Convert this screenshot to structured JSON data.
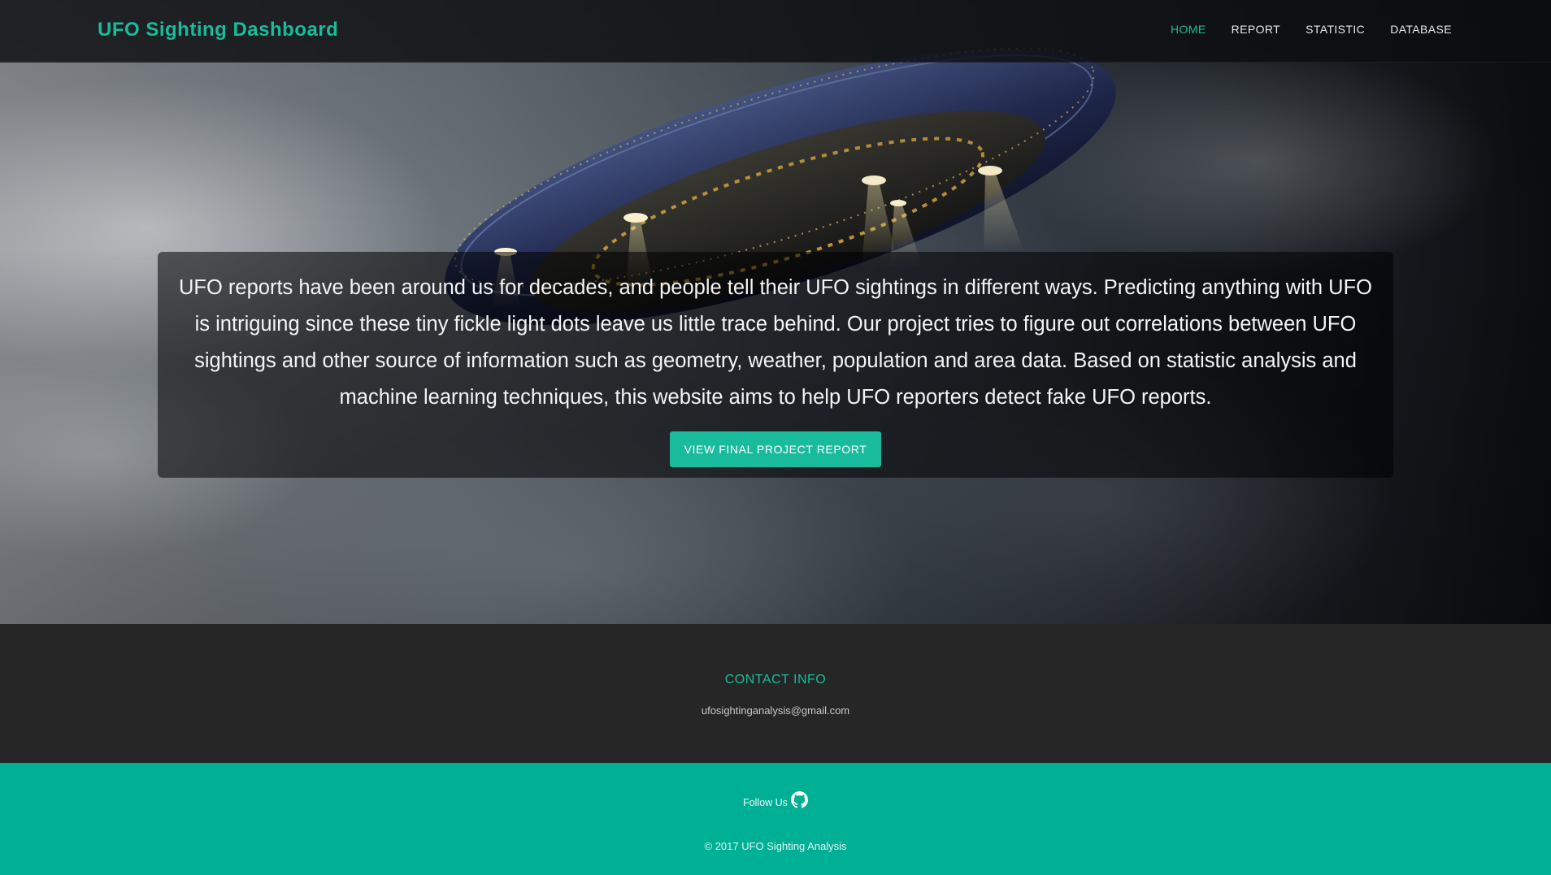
{
  "navbar": {
    "brand": "UFO Sighting Dashboard",
    "items": [
      {
        "label": "HOME",
        "active": true
      },
      {
        "label": "REPORT",
        "active": false
      },
      {
        "label": "STATISTIC",
        "active": false
      },
      {
        "label": "DATABASE",
        "active": false
      }
    ]
  },
  "intro": {
    "text": "UFO reports have been around us for decades, and people tell their UFO sightings in different ways. Predicting anything with UFO is intriguing since these tiny fickle light dots leave us little trace behind. Our project tries to figure out correlations between UFO sightings and other source of information such as geometry, weather, population and area data. Based on statistic analysis and machine learning techniques, this website aims to help UFO reporters detect fake UFO reports.",
    "button_label": "VIEW FINAL PROJECT REPORT"
  },
  "contact": {
    "title": "CONTACT INFO",
    "email": "ufosightinganalysis@gmail.com"
  },
  "footer": {
    "follow_label": "Follow Us",
    "follow_icon": "github-icon",
    "copyright": "© 2017 UFO Sighting Analysis"
  },
  "colors": {
    "accent": "#18bc9c",
    "footer_bg": "#00b095",
    "contact_bg": "#262626"
  }
}
